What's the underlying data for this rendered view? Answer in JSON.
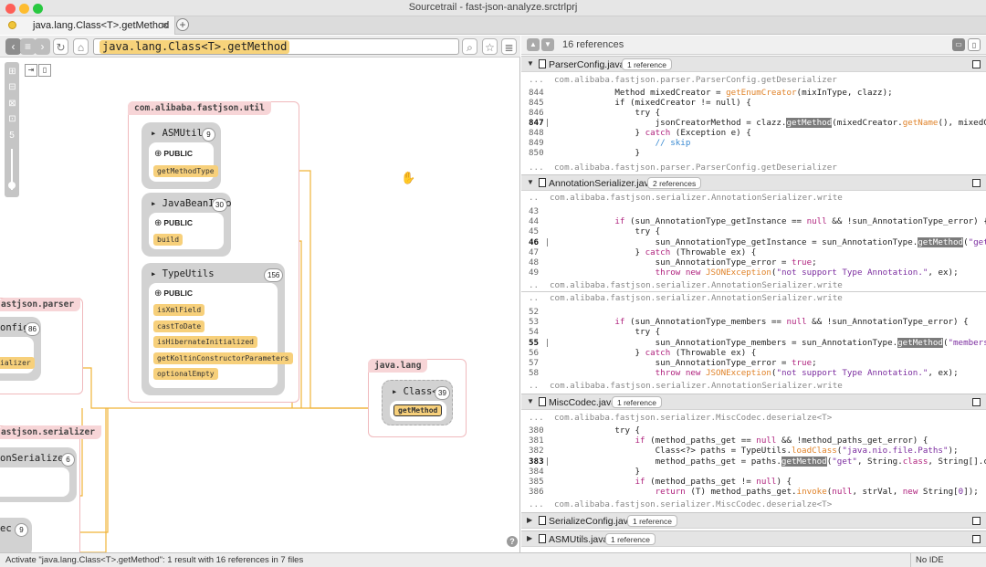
{
  "window": {
    "title": "Sourcetrail - fast-json-analyze.srctrlprj",
    "tab_label": "java.lang.Class<T>.getMethod",
    "tab_close": "×",
    "new_tab": "+"
  },
  "toolbar": {
    "search_query": "java.lang.Class<T>.getMethod"
  },
  "graph": {
    "zoom_level": "5",
    "packages": [
      {
        "label": "com.alibaba.fastjson.util"
      },
      {
        "label": "astjson.parser"
      },
      {
        "label": "astjson.serializer"
      },
      {
        "label": "java.lang"
      }
    ],
    "classes": {
      "asmutils": {
        "name": "ASMUtils",
        "count": "9",
        "access": "PUBLIC",
        "members": [
          "getMethodType"
        ]
      },
      "javabeaninfo": {
        "name": "JavaBeanInfo",
        "count": "30",
        "access": "PUBLIC",
        "members": [
          "build"
        ]
      },
      "typeutils": {
        "name": "TypeUtils",
        "count": "156",
        "access": "PUBLIC",
        "members": [
          "isXmlField",
          "castToDate",
          "isHibernateInitialized",
          "getKoltinConstructorParameters",
          "optionalEmpty"
        ]
      },
      "parserconfig": {
        "name": "onfig",
        "count": "86",
        "members": [
          "ializer"
        ]
      },
      "serializer": {
        "name": "onSerializer",
        "count": "6"
      },
      "misccodec": {
        "name": "ec",
        "count": "9"
      },
      "classt": {
        "name": "Class<T>",
        "count": "39",
        "members": [
          "getMethod"
        ]
      }
    },
    "help": "?"
  },
  "code": {
    "reference_count": "16 references",
    "files": [
      {
        "name": "ParserConfig.java",
        "badge": "1 reference",
        "context_top": "com.alibaba.fastjson.parser.ParserConfig.getDeserializer",
        "lines": [
          {
            "n": "844",
            "t": "            Method mixedCreator = getEnumCreator(mixInType, clazz);"
          },
          {
            "n": "845",
            "t": "            if (mixedCreator != null) {"
          },
          {
            "n": "846",
            "t": "                try {"
          },
          {
            "n": "847",
            "t": "                    jsonCreatorMethod = clazz.getMethod(mixedCreator.getName(), mixedCr"
          },
          {
            "n": "848",
            "t": "                } catch (Exception e) {"
          },
          {
            "n": "849",
            "t": "                    // skip"
          },
          {
            "n": "850",
            "t": "                }"
          }
        ],
        "context_bottom": "com.alibaba.fastjson.parser.ParserConfig.getDeserializer"
      },
      {
        "name": "AnnotationSerializer.java",
        "badge": "2 references",
        "context_top": "com.alibaba.fastjson.serializer.AnnotationSerializer.write",
        "lines": [
          {
            "n": "43",
            "t": ""
          },
          {
            "n": "44",
            "t": "            if (sun_AnnotationType_getInstance == null && !sun_AnnotationType_error) {"
          },
          {
            "n": "45",
            "t": "                try {"
          },
          {
            "n": "46",
            "t": "                    sun_AnnotationType_getInstance = sun_AnnotationType.getMethod(\"getInsta"
          },
          {
            "n": "47",
            "t": "                } catch (Throwable ex) {"
          },
          {
            "n": "48",
            "t": "                    sun_AnnotationType_error = true;"
          },
          {
            "n": "49",
            "t": "                    throw new JSONException(\"not support Type Annotation.\", ex);"
          }
        ],
        "context_mid1": "com.alibaba.fastjson.serializer.AnnotationSerializer.write",
        "context_mid2": "com.alibaba.fastjson.serializer.AnnotationSerializer.write",
        "lines2": [
          {
            "n": "52",
            "t": ""
          },
          {
            "n": "53",
            "t": "            if (sun_AnnotationType_members == null && !sun_AnnotationType_error) {"
          },
          {
            "n": "54",
            "t": "                try {"
          },
          {
            "n": "55",
            "t": "                    sun_AnnotationType_members = sun_AnnotationType.getMethod(\"members\");"
          },
          {
            "n": "56",
            "t": "                } catch (Throwable ex) {"
          },
          {
            "n": "57",
            "t": "                    sun_AnnotationType_error = true;"
          },
          {
            "n": "58",
            "t": "                    throw new JSONException(\"not support Type Annotation.\", ex);"
          }
        ],
        "context_bottom": "com.alibaba.fastjson.serializer.AnnotationSerializer.write"
      },
      {
        "name": "MiscCodec.java",
        "badge": "1 reference",
        "context_top": "com.alibaba.fastjson.serializer.MiscCodec.deserialze<T>",
        "lines": [
          {
            "n": "380",
            "t": "            try {"
          },
          {
            "n": "381",
            "t": "                if (method_paths_get == null && !method_paths_get_error) {"
          },
          {
            "n": "382",
            "t": "                    Class<?> paths = TypeUtils.loadClass(\"java.nio.file.Paths\");"
          },
          {
            "n": "383",
            "t": "                    method_paths_get = paths.getMethod(\"get\", String.class, String[].cl"
          },
          {
            "n": "384",
            "t": "                }"
          },
          {
            "n": "385",
            "t": "                if (method_paths_get != null) {"
          },
          {
            "n": "386",
            "t": "                    return (T) method_paths_get.invoke(null, strVal, new String[0]);"
          }
        ],
        "context_bottom": "com.alibaba.fastjson.serializer.MiscCodec.deserialze<T>"
      },
      {
        "name": "SerializeConfig.java",
        "badge": "1 reference"
      },
      {
        "name": "ASMUtils.java",
        "badge": "1 reference"
      }
    ]
  },
  "status": {
    "message": "Activate \"java.lang.Class<T>.getMethod\": 1 result with 16 references in 7 files",
    "ide": "No IDE connected"
  },
  "colors": {
    "member_highlight": "#f7d07b",
    "edge": "#f0b338",
    "package_border": "#f0b9bc",
    "code_highlight": "#7b7b7b"
  }
}
